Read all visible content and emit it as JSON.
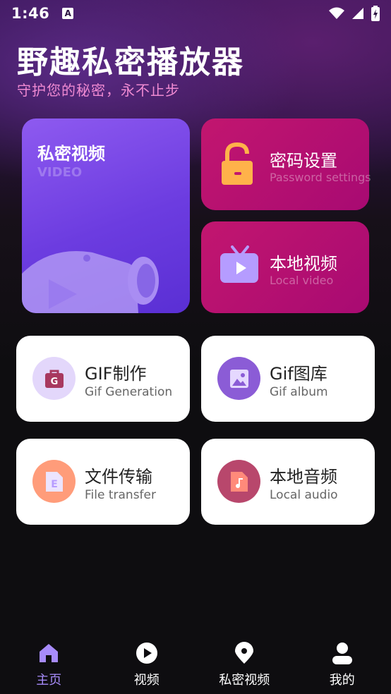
{
  "status_bar": {
    "time": "1:46",
    "notification_badge": "A"
  },
  "header": {
    "title": "野趣私密播放器",
    "subtitle": "守护您的秘密，永不止步"
  },
  "private_video": {
    "title": "私密视频",
    "subtitle": "VIDEO"
  },
  "password_settings": {
    "label": "密码设置",
    "sublabel": "Password settings"
  },
  "local_video": {
    "label": "本地视频",
    "sublabel": "Local video"
  },
  "tiles": [
    {
      "label": "GIF制作",
      "sublabel": "Gif Generation",
      "icon": "gif-make-icon",
      "color": "#e3d7fb"
    },
    {
      "label": "Gif图库",
      "sublabel": "Gif album",
      "icon": "gif-album-icon",
      "color": "#8b5cd6"
    },
    {
      "label": "文件传输",
      "sublabel": "File transfer",
      "icon": "file-transfer-icon",
      "color": "#ff9c7a"
    },
    {
      "label": "本地音频",
      "sublabel": "Local audio",
      "icon": "local-audio-icon",
      "color": "#b8476c"
    }
  ],
  "tab_bar": {
    "items": [
      {
        "label": "主页",
        "icon": "home-icon",
        "active": true
      },
      {
        "label": "视频",
        "icon": "play-icon",
        "active": false
      },
      {
        "label": "私密视频",
        "icon": "location-pin-icon",
        "active": false
      },
      {
        "label": "我的",
        "icon": "person-icon",
        "active": false
      }
    ]
  },
  "colors": {
    "accent": "#a78bfa",
    "private_card": "#6c3ce0",
    "pink_card": "#b50f70",
    "subtitle": "#f08ad2"
  }
}
